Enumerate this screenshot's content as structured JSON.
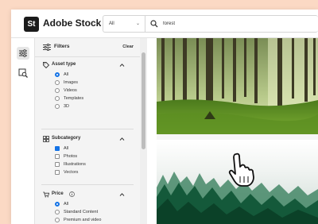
{
  "app": {
    "logo_text": "St",
    "brand": "Adobe Stock"
  },
  "search": {
    "category": "All",
    "query": "forest"
  },
  "filters_panel": {
    "title": "Filters",
    "clear_label": "Clear"
  },
  "sections": {
    "asset_type": {
      "title": "Asset type",
      "options": [
        "All",
        "Images",
        "Videos",
        "Templates",
        "3D"
      ],
      "selected": "All"
    },
    "subcategory": {
      "title": "Subcategory",
      "options": [
        "All",
        "Photos",
        "Illustrations",
        "Vectors"
      ],
      "selected": "All"
    },
    "price": {
      "title": "Price",
      "options": [
        "All",
        "Standard Content",
        "Premium and video"
      ],
      "selected": "All"
    }
  },
  "results": [
    {
      "icon": "forest-sunlight-photo"
    },
    {
      "icon": "misty-pine-forest-photo"
    }
  ],
  "colors": {
    "accent": "#1473e6",
    "page_bg": "#fbd9c4",
    "panel_bg": "#f4f4f4"
  }
}
